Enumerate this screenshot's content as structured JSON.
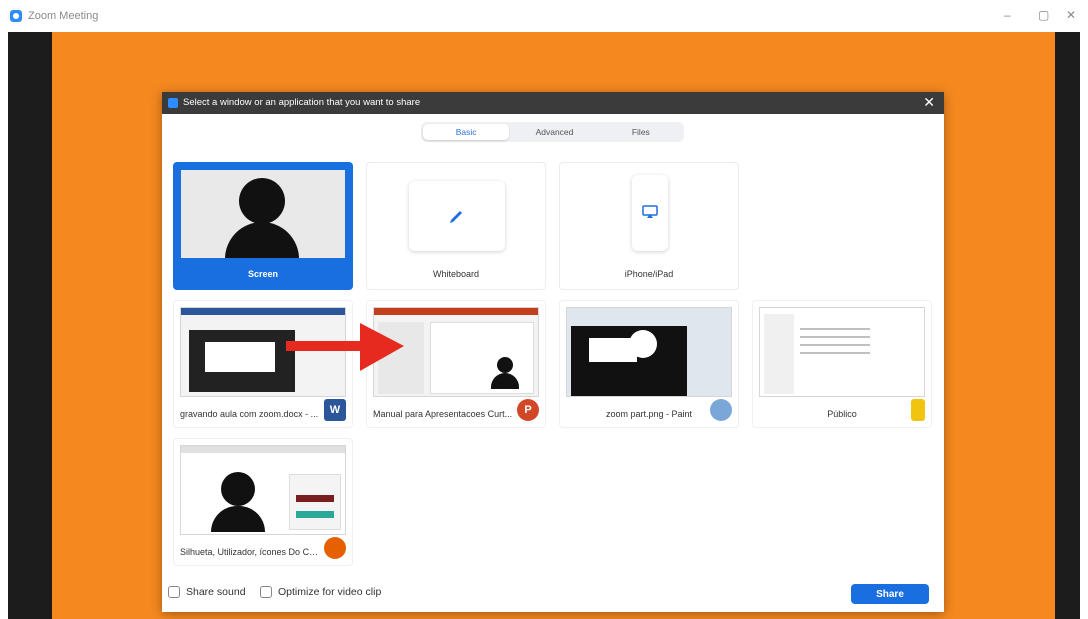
{
  "app": {
    "title": "Zoom Meeting",
    "minimize": "–",
    "restore": "▢",
    "close": "✕"
  },
  "dialog": {
    "title": "Select a window or an application that you want to share",
    "close": "✕",
    "tabs": [
      {
        "label": "Basic",
        "active": true
      },
      {
        "label": "Advanced",
        "active": false
      },
      {
        "label": "Files",
        "active": false
      }
    ],
    "top_tiles": [
      {
        "label": "Screen",
        "selected": true
      },
      {
        "label": "Whiteboard",
        "selected": false
      },
      {
        "label": "iPhone/iPad",
        "selected": false
      }
    ],
    "windows": [
      {
        "label": "gravando aula com zoom.docx - ...",
        "app": "word-icon",
        "badge": "W",
        "badge_color": "#2b579a"
      },
      {
        "label": "Manual para Apresentacoes Curt...",
        "app": "powerpoint-icon",
        "badge": "P",
        "badge_color": "#d24726"
      },
      {
        "label": "zoom part.png - Paint",
        "app": "paint-icon",
        "badge": "",
        "badge_color": "#7aa7d8"
      },
      {
        "label": "Público",
        "app": "folder-icon",
        "badge": "",
        "badge_color": "#f1c40f"
      },
      {
        "label": "Silhueta, Utilizador, ícones Do Co...",
        "app": "firefox-icon",
        "badge": "",
        "badge_color": "#e66000"
      }
    ],
    "footer": {
      "share_sound": "Share sound",
      "optimize": "Optimize for video clip",
      "share_button": "Share"
    }
  },
  "colors": {
    "accent": "#1a6fe0",
    "stage": "#f5881f",
    "titlebar": "#3b3b3b"
  }
}
